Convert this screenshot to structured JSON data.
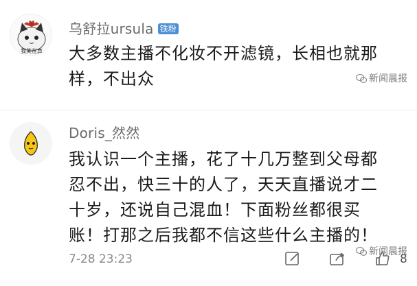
{
  "comments": [
    {
      "username": "乌舒拉ursula",
      "badge": "铁粉",
      "avatar_caption": "我美在真",
      "text": "大多数主播不化妆不开滤镜，长相也就那样，不出众",
      "watermark": "新闻晨报"
    },
    {
      "username": "Doris_然然",
      "text": "我认识一个主播，花了十几万整到父母都忍不出，快三十的人了，天天直播说才二十岁，还说自己混血！下面粉丝都很买账！打那之后我都不信这些什么主播的！",
      "watermark": "新闻晨报",
      "timestamp": "7-28 23:23",
      "like_count": "8"
    }
  ],
  "icons": {
    "reply": "edit-icon",
    "share": "share-icon",
    "like": "thumbs-up-icon"
  },
  "colors": {
    "badge": "#4c8fd6",
    "username": "#6a6a6a",
    "text": "#1a1a1a"
  }
}
